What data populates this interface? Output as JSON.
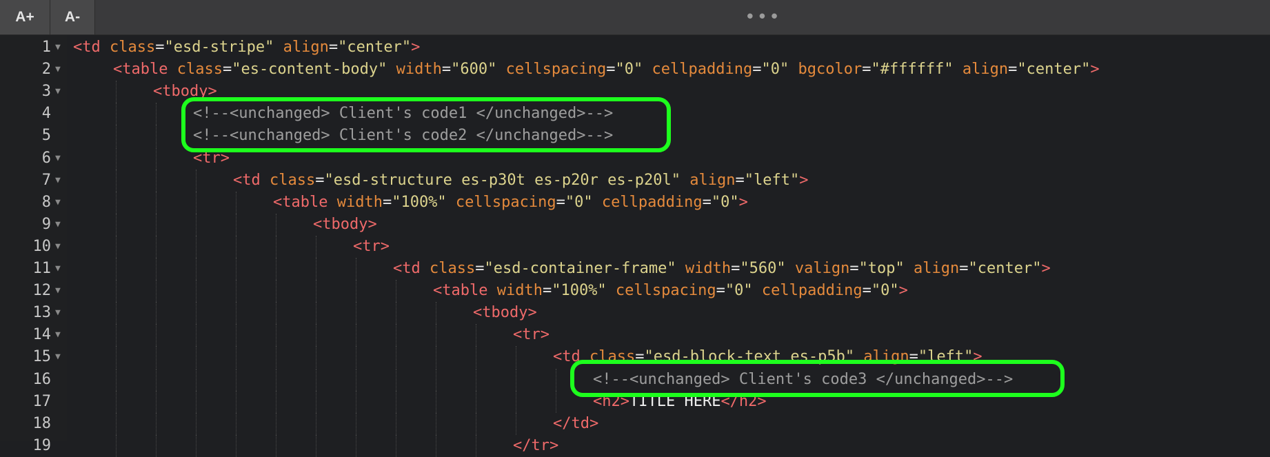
{
  "toolbar": {
    "font_increase_label": "A+",
    "font_decrease_label": "A-",
    "more_label": "•••"
  },
  "lines": [
    {
      "num": "1",
      "indent": 0,
      "fold": true,
      "tokens": [
        [
          "tag",
          "<td "
        ],
        [
          "attr",
          "class"
        ],
        [
          "eq",
          "="
        ],
        [
          "val",
          "\"esd-stripe\""
        ],
        [
          "attr",
          " align"
        ],
        [
          "eq",
          "="
        ],
        [
          "val",
          "\"center\""
        ],
        [
          "tag",
          ">"
        ]
      ]
    },
    {
      "num": "2",
      "indent": 1,
      "fold": true,
      "tokens": [
        [
          "tag",
          "<table "
        ],
        [
          "attr",
          "class"
        ],
        [
          "eq",
          "="
        ],
        [
          "val",
          "\"es-content-body\""
        ],
        [
          "attr",
          " width"
        ],
        [
          "eq",
          "="
        ],
        [
          "val",
          "\"600\""
        ],
        [
          "attr",
          " cellspacing"
        ],
        [
          "eq",
          "="
        ],
        [
          "val",
          "\"0\""
        ],
        [
          "attr",
          " cellpadding"
        ],
        [
          "eq",
          "="
        ],
        [
          "val",
          "\"0\""
        ],
        [
          "attr",
          " bgcolor"
        ],
        [
          "eq",
          "="
        ],
        [
          "val",
          "\"#ffffff\""
        ],
        [
          "attr",
          " align"
        ],
        [
          "eq",
          "="
        ],
        [
          "val",
          "\"center\""
        ],
        [
          "tag",
          ">"
        ]
      ]
    },
    {
      "num": "3",
      "indent": 2,
      "fold": true,
      "tokens": [
        [
          "tag",
          "<tbody>"
        ]
      ]
    },
    {
      "num": "4",
      "indent": 3,
      "fold": false,
      "tokens": [
        [
          "comment",
          "<!--<unchanged> Client's code1 </unchanged>-->"
        ]
      ]
    },
    {
      "num": "5",
      "indent": 3,
      "fold": false,
      "tokens": [
        [
          "comment",
          "<!--<unchanged> Client's code2 </unchanged>-->"
        ]
      ]
    },
    {
      "num": "6",
      "indent": 3,
      "fold": true,
      "tokens": [
        [
          "tag",
          "<tr>"
        ]
      ]
    },
    {
      "num": "7",
      "indent": 4,
      "fold": true,
      "tokens": [
        [
          "tag",
          "<td "
        ],
        [
          "attr",
          "class"
        ],
        [
          "eq",
          "="
        ],
        [
          "val",
          "\"esd-structure es-p30t es-p20r es-p20l\""
        ],
        [
          "attr",
          " align"
        ],
        [
          "eq",
          "="
        ],
        [
          "val",
          "\"left\""
        ],
        [
          "tag",
          ">"
        ]
      ]
    },
    {
      "num": "8",
      "indent": 5,
      "fold": true,
      "tokens": [
        [
          "tag",
          "<table "
        ],
        [
          "attr",
          "width"
        ],
        [
          "eq",
          "="
        ],
        [
          "val",
          "\"100%\""
        ],
        [
          "attr",
          " cellspacing"
        ],
        [
          "eq",
          "="
        ],
        [
          "val",
          "\"0\""
        ],
        [
          "attr",
          " cellpadding"
        ],
        [
          "eq",
          "="
        ],
        [
          "val",
          "\"0\""
        ],
        [
          "tag",
          ">"
        ]
      ]
    },
    {
      "num": "9",
      "indent": 6,
      "fold": true,
      "tokens": [
        [
          "tag",
          "<tbody>"
        ]
      ]
    },
    {
      "num": "10",
      "indent": 7,
      "fold": true,
      "tokens": [
        [
          "tag",
          "<tr>"
        ]
      ]
    },
    {
      "num": "11",
      "indent": 8,
      "fold": true,
      "tokens": [
        [
          "tag",
          "<td "
        ],
        [
          "attr",
          "class"
        ],
        [
          "eq",
          "="
        ],
        [
          "val",
          "\"esd-container-frame\""
        ],
        [
          "attr",
          " width"
        ],
        [
          "eq",
          "="
        ],
        [
          "val",
          "\"560\""
        ],
        [
          "attr",
          " valign"
        ],
        [
          "eq",
          "="
        ],
        [
          "val",
          "\"top\""
        ],
        [
          "attr",
          " align"
        ],
        [
          "eq",
          "="
        ],
        [
          "val",
          "\"center\""
        ],
        [
          "tag",
          ">"
        ]
      ]
    },
    {
      "num": "12",
      "indent": 9,
      "fold": true,
      "tokens": [
        [
          "tag",
          "<table "
        ],
        [
          "attr",
          "width"
        ],
        [
          "eq",
          "="
        ],
        [
          "val",
          "\"100%\""
        ],
        [
          "attr",
          " cellspacing"
        ],
        [
          "eq",
          "="
        ],
        [
          "val",
          "\"0\""
        ],
        [
          "attr",
          " cellpadding"
        ],
        [
          "eq",
          "="
        ],
        [
          "val",
          "\"0\""
        ],
        [
          "tag",
          ">"
        ]
      ]
    },
    {
      "num": "13",
      "indent": 10,
      "fold": true,
      "tokens": [
        [
          "tag",
          "<tbody>"
        ]
      ]
    },
    {
      "num": "14",
      "indent": 11,
      "fold": true,
      "tokens": [
        [
          "tag",
          "<tr>"
        ]
      ]
    },
    {
      "num": "15",
      "indent": 12,
      "fold": true,
      "tokens": [
        [
          "tag",
          "<td "
        ],
        [
          "attr",
          "class"
        ],
        [
          "eq",
          "="
        ],
        [
          "val",
          "\"esd-block-text es-p5b\""
        ],
        [
          "attr",
          " align"
        ],
        [
          "eq",
          "="
        ],
        [
          "val",
          "\"left\""
        ],
        [
          "tag",
          ">"
        ]
      ]
    },
    {
      "num": "16",
      "indent": 13,
      "fold": false,
      "tokens": [
        [
          "comment",
          "<!--<unchanged> Client's code3 </unchanged>-->"
        ]
      ]
    },
    {
      "num": "17",
      "indent": 13,
      "fold": false,
      "tokens": [
        [
          "tag",
          "<h2>"
        ],
        [
          "text",
          "TITLE HERE"
        ],
        [
          "tag",
          "</h2>"
        ]
      ]
    },
    {
      "num": "18",
      "indent": 12,
      "fold": false,
      "tokens": [
        [
          "tag",
          "</td>"
        ]
      ]
    },
    {
      "num": "19",
      "indent": 11,
      "fold": false,
      "tokens": [
        [
          "tag",
          "</tr>"
        ]
      ]
    }
  ],
  "colors": {
    "tag": "#ef6a6a",
    "attribute": "#e58a3c",
    "value": "#dcd38d",
    "comment": "#9e9e9e",
    "highlight": "#1dff1d"
  }
}
